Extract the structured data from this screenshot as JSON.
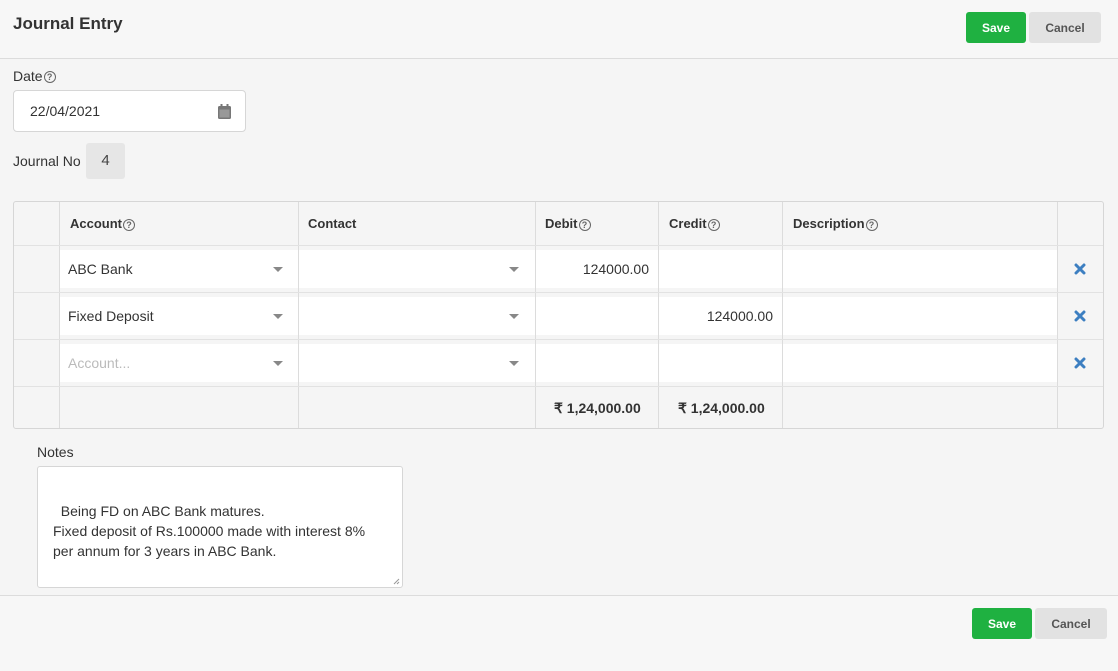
{
  "header": {
    "title": "Journal Entry",
    "save_label": "Save",
    "cancel_label": "Cancel"
  },
  "form": {
    "date_label": "Date",
    "date_value": "22/04/2021",
    "journal_no_label": "Journal No",
    "journal_no_value": "4"
  },
  "grid": {
    "columns": {
      "account": "Account",
      "contact": "Contact",
      "debit": "Debit",
      "credit": "Credit",
      "description": "Description"
    },
    "rows": [
      {
        "account": "ABC Bank",
        "contact": "",
        "debit": "124000.00",
        "credit": "",
        "description": ""
      },
      {
        "account": "Fixed Deposit",
        "contact": "",
        "debit": "",
        "credit": "124000.00",
        "description": ""
      },
      {
        "account_placeholder": "Account...",
        "contact": "",
        "debit": "",
        "credit": "",
        "description": ""
      }
    ],
    "totals": {
      "debit": "₹ 1,24,000.00",
      "credit": "₹ 1,24,000.00"
    }
  },
  "notes": {
    "label": "Notes",
    "text": "Being FD on ABC Bank matures.\nFixed deposit of Rs.100000 made with interest 8%\nper annum for 3 years in ABC Bank."
  },
  "footer": {
    "save_label": "Save",
    "cancel_label": "Cancel"
  },
  "colors": {
    "save": "#1fb141",
    "cancel": "#e2e2e2",
    "delete_icon": "#3d7fc1"
  },
  "icons": {
    "help": "help-circle-icon",
    "calendar": "calendar-icon",
    "dropdown": "caret-down-icon",
    "delete": "close-icon",
    "resize": "resize-handle-icon"
  }
}
